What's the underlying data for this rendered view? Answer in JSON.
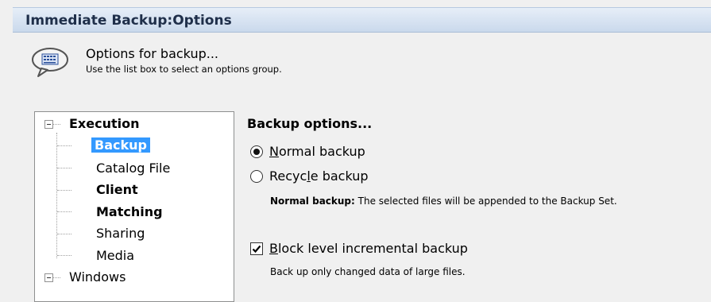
{
  "window": {
    "title": "Immediate Backup:Options"
  },
  "header": {
    "icon": "speech-bubble-icon",
    "title": "Options for backup...",
    "subtitle": "Use the list box to select an options group."
  },
  "tree": {
    "group1": {
      "label": "Execution",
      "expanded": true
    },
    "items": [
      {
        "label": "Backup",
        "selected": true,
        "bold": true
      },
      {
        "label": "Catalog File",
        "bold": false
      },
      {
        "label": "Client",
        "bold": true
      },
      {
        "label": "Matching",
        "bold": true
      },
      {
        "label": "Sharing",
        "bold": false
      },
      {
        "label": "Media",
        "bold": false
      }
    ],
    "group2": {
      "label": "Windows",
      "expanded": true
    }
  },
  "options": {
    "section_title": "Backup options...",
    "radio_normal": {
      "label": "Normal backup",
      "accesskey": "N",
      "rest": "ormal backup",
      "checked": true
    },
    "radio_recycle": {
      "label": "Recycle backup",
      "pre": "Recyc",
      "accesskey": "l",
      "rest": "e backup",
      "checked": false
    },
    "note_label": "Normal backup:",
    "note_text": " The selected files will be appended to the Backup Set.",
    "block_level": {
      "label": "Block level incremental backup",
      "accesskey": "B",
      "rest": "lock level incremental backup",
      "checked": true
    },
    "block_level_note": "Back up only changed data of large files."
  },
  "colors": {
    "selection": "#3399ff",
    "title_bar": "#cad9ec"
  }
}
